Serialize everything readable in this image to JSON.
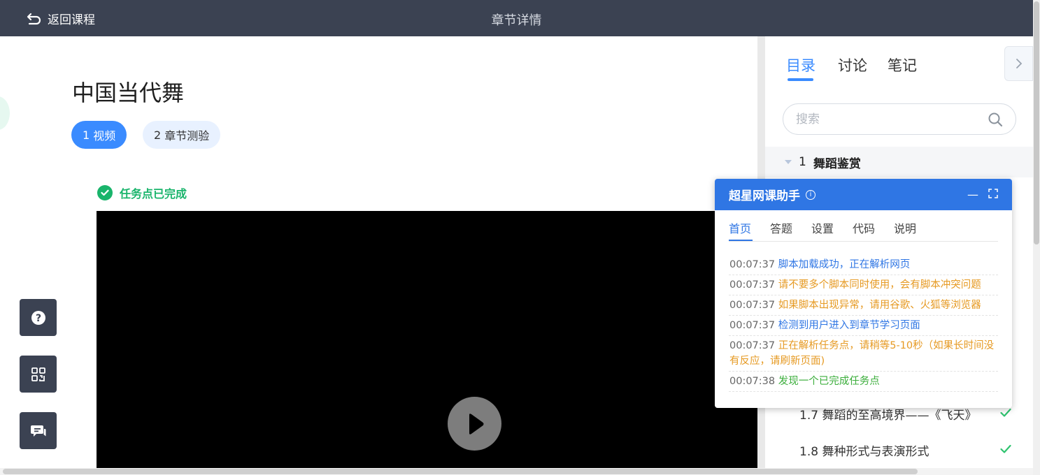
{
  "topbar": {
    "back_label": "返回课程",
    "title": "章节详情"
  },
  "main": {
    "course_title": "中国当代舞",
    "steps": [
      {
        "num": "1",
        "label": "视频"
      },
      {
        "num": "2",
        "label": "章节测验"
      }
    ],
    "task_status": "任务点已完成"
  },
  "panel": {
    "tabs": [
      "目录",
      "讨论",
      "笔记"
    ],
    "search_placeholder": "搜索",
    "chapter": {
      "num": "1",
      "name": "舞蹈鉴赏"
    },
    "lessons": [
      {
        "label": "1.7 舞蹈的至高境界——《飞天》",
        "done": true
      },
      {
        "label": "1.8 舞种形式与表演形式",
        "done": true
      }
    ]
  },
  "helper": {
    "title": "超星网课助手",
    "info_icon": "①",
    "tabs": [
      "首页",
      "答题",
      "设置",
      "代码",
      "说明"
    ],
    "logs": [
      {
        "time": "00:07:37",
        "msg": "脚本加载成功，正在解析网页",
        "color": "#2f76e4"
      },
      {
        "time": "00:07:37",
        "msg": "请不要多个脚本同时使用，会有脚本冲突问题",
        "color": "#e69a23"
      },
      {
        "time": "00:07:37",
        "msg": "如果脚本出现异常，请用谷歌、火狐等浏览器",
        "color": "#e69a23"
      },
      {
        "time": "00:07:37",
        "msg": "检测到用户进入到章节学习页面",
        "color": "#2f76e4"
      },
      {
        "time": "00:07:37",
        "msg": "正在解析任务点，请稍等5-10秒（如果长时间没有反应，请刷新页面)",
        "color": "#e69a23"
      },
      {
        "time": "00:07:38",
        "msg": "发现一个已完成任务点",
        "color": "#3cae3c"
      }
    ]
  },
  "colors": {
    "topbar": "#3b4252",
    "accent": "#3a8bff",
    "success": "#19b46b"
  }
}
